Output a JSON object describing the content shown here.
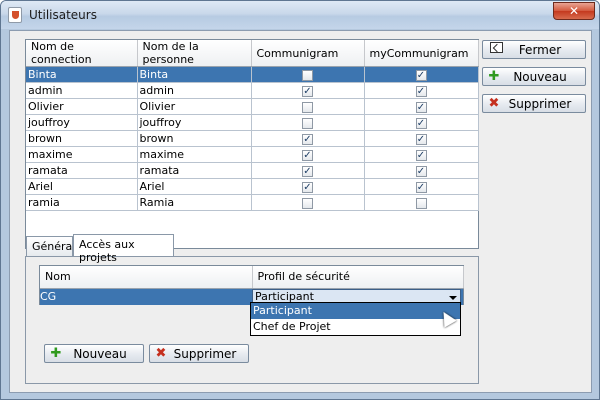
{
  "window": {
    "title": "Utilisateurs",
    "close_label": "✕"
  },
  "users_table": {
    "columns": [
      "Nom de connection",
      "Nom de la personne",
      "Communigram",
      "myCommunigram"
    ],
    "rows": [
      {
        "login": "Binta",
        "name": "Binta",
        "communigram": false,
        "mycommunigram": true,
        "selected": true
      },
      {
        "login": "admin",
        "name": "admin",
        "communigram": true,
        "mycommunigram": true
      },
      {
        "login": "Olivier",
        "name": "Olivier",
        "communigram": false,
        "mycommunigram": true
      },
      {
        "login": "jouffroy",
        "name": "jouffroy",
        "communigram": false,
        "mycommunigram": true
      },
      {
        "login": "brown",
        "name": "brown",
        "communigram": true,
        "mycommunigram": true
      },
      {
        "login": "maxime",
        "name": "maxime",
        "communigram": true,
        "mycommunigram": true
      },
      {
        "login": "ramata",
        "name": "ramata",
        "communigram": true,
        "mycommunigram": true
      },
      {
        "login": "Ariel",
        "name": "Ariel",
        "communigram": true,
        "mycommunigram": true
      },
      {
        "login": "ramia",
        "name": "Ramia",
        "communigram": false,
        "mycommunigram": false
      }
    ]
  },
  "actions": {
    "close_label": "Fermer",
    "new_label": "Nouveau",
    "delete_label": "Supprimer"
  },
  "tabs": [
    {
      "label": "Général",
      "active": false
    },
    {
      "label": "Accès aux projets",
      "active": true
    }
  ],
  "projects_table": {
    "columns": [
      "Nom",
      "Profil de sécurité"
    ],
    "rows": [
      {
        "name": "CG",
        "profile": "Participant",
        "selected": true
      }
    ]
  },
  "profile_dropdown": {
    "options": [
      "Participant",
      "Chef de Projet"
    ],
    "highlighted": "Participant"
  },
  "project_actions": {
    "new_label": "Nouveau",
    "delete_label": "Supprimer"
  },
  "colors": {
    "selection": "#3d75b0",
    "check": "#1f3f66",
    "add": "#2f9a1f",
    "delete": "#c5301f"
  }
}
